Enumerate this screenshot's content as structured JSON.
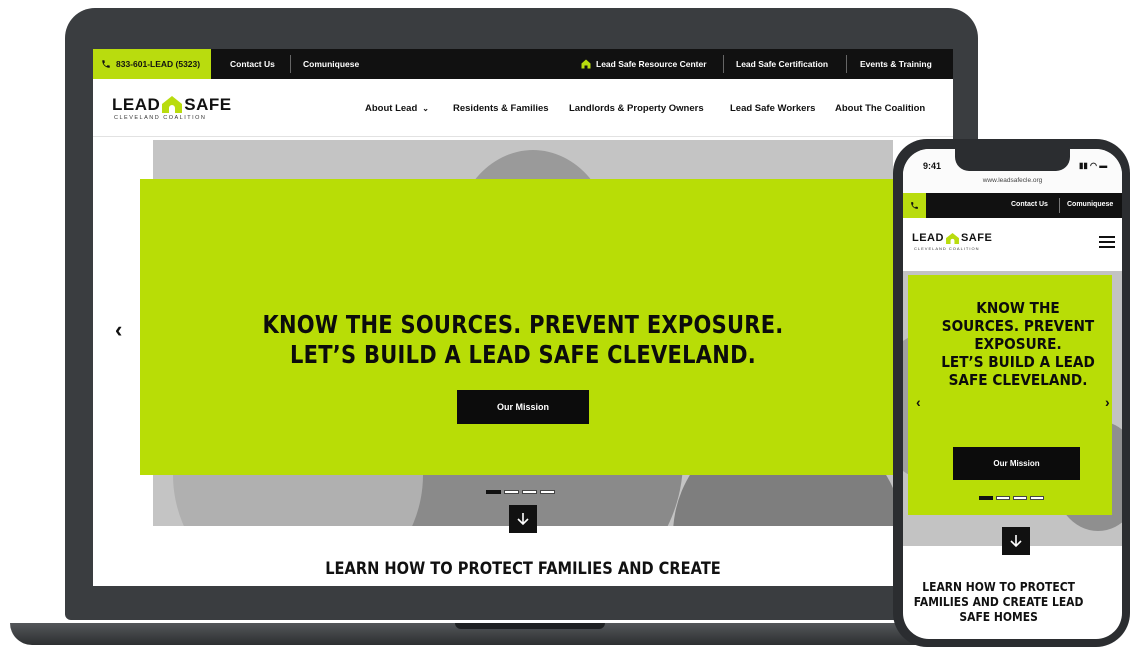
{
  "desktop": {
    "utility_bar": {
      "phone": "833-601-LEAD (5323)",
      "contact": "Contact Us",
      "comuniquese": "Comuniquese",
      "resource_center": "Lead Safe Resource Center",
      "certification": "Lead Safe Certification",
      "events": "Events & Training"
    },
    "logo": {
      "main_left": "LEAD",
      "main_right": "SAFE",
      "sub": "CLEVELAND COALITION"
    },
    "nav": {
      "about_lead": "About Lead",
      "residents": "Residents & Families",
      "landlords": "Landlords & Property Owners",
      "workers": "Lead Safe Workers",
      "coalition": "About The Coalition"
    },
    "hero": {
      "headline_1": "KNOW THE SOURCES. PREVENT EXPOSURE.",
      "headline_2": "LET’S BUILD A LEAD SAFE CLEVELAND.",
      "button": "Our Mission",
      "prev": "‹",
      "slide_count": 4,
      "active_slide": 1
    },
    "learn_heading": "LEARN HOW TO PROTECT FAMILIES AND CREATE"
  },
  "mobile": {
    "status": {
      "time": "9:41",
      "url": "www.leadsafecle.org"
    },
    "utility_bar": {
      "contact": "Contact Us",
      "comuniquese": "Comuniquese"
    },
    "logo": {
      "main_left": "LEAD",
      "main_right": "SAFE",
      "sub": "CLEVELAND COALITION"
    },
    "hero": {
      "headline_1": "KNOW THE",
      "headline_2": "SOURCES. PREVENT",
      "headline_3": "EXPOSURE.",
      "headline_4": "LET’S BUILD A LEAD",
      "headline_5": "SAFE CLEVELAND.",
      "button": "Our Mission",
      "prev": "‹",
      "next": "›"
    },
    "learn_line_1": "LEARN HOW TO PROTECT",
    "learn_line_2": "FAMILIES AND CREATE LEAD",
    "learn_line_3": "SAFE HOMES"
  },
  "colors": {
    "accent": "#b8dd06",
    "dark": "#111111",
    "device": "#3a3d40"
  }
}
